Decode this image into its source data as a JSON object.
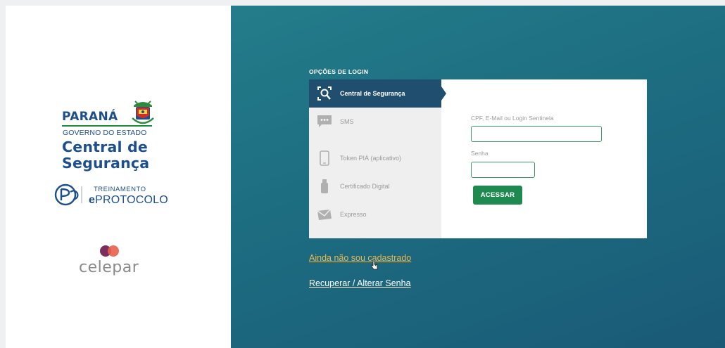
{
  "brand": {
    "state_name": "PARANÁ",
    "state_subtitle": "GOVERNO DO ESTADO",
    "title_line1": "Central de",
    "title_line2": "Segurança",
    "training_label": "TREINAMENTO",
    "eprotocolo_prefix": "e",
    "eprotocolo_main": "PROTOCOLO",
    "company": "celepar"
  },
  "login": {
    "section_title": "OPÇÕES DE LOGIN",
    "options": [
      {
        "label": "Central de Segurança",
        "icon": "security-center-icon",
        "active": true
      },
      {
        "label": "SMS",
        "icon": "sms-icon",
        "active": false
      },
      {
        "label": "Token PIÁ (aplicativo)",
        "icon": "phone-icon",
        "active": false
      },
      {
        "label": "Certificado Digital",
        "icon": "usb-token-icon",
        "active": false
      },
      {
        "label": "Expresso",
        "icon": "mail-icon",
        "active": false
      }
    ],
    "user_label": "CPF, E-Mail ou Login Sentinela",
    "user_value": "",
    "password_label": "Senha",
    "password_value": "",
    "submit_label": "ACESSAR"
  },
  "links": {
    "register": "Ainda não sou cadastrado",
    "recover": "Recuperar / Alterar Senha"
  },
  "colors": {
    "brand_blue": "#1d4f8f",
    "brand_green": "#1a8a3a",
    "hero_teal": "#1d6e81",
    "active_tab": "#1f4e6e",
    "button_green": "#1f8a4f",
    "link_highlight": "#f0b84a"
  }
}
